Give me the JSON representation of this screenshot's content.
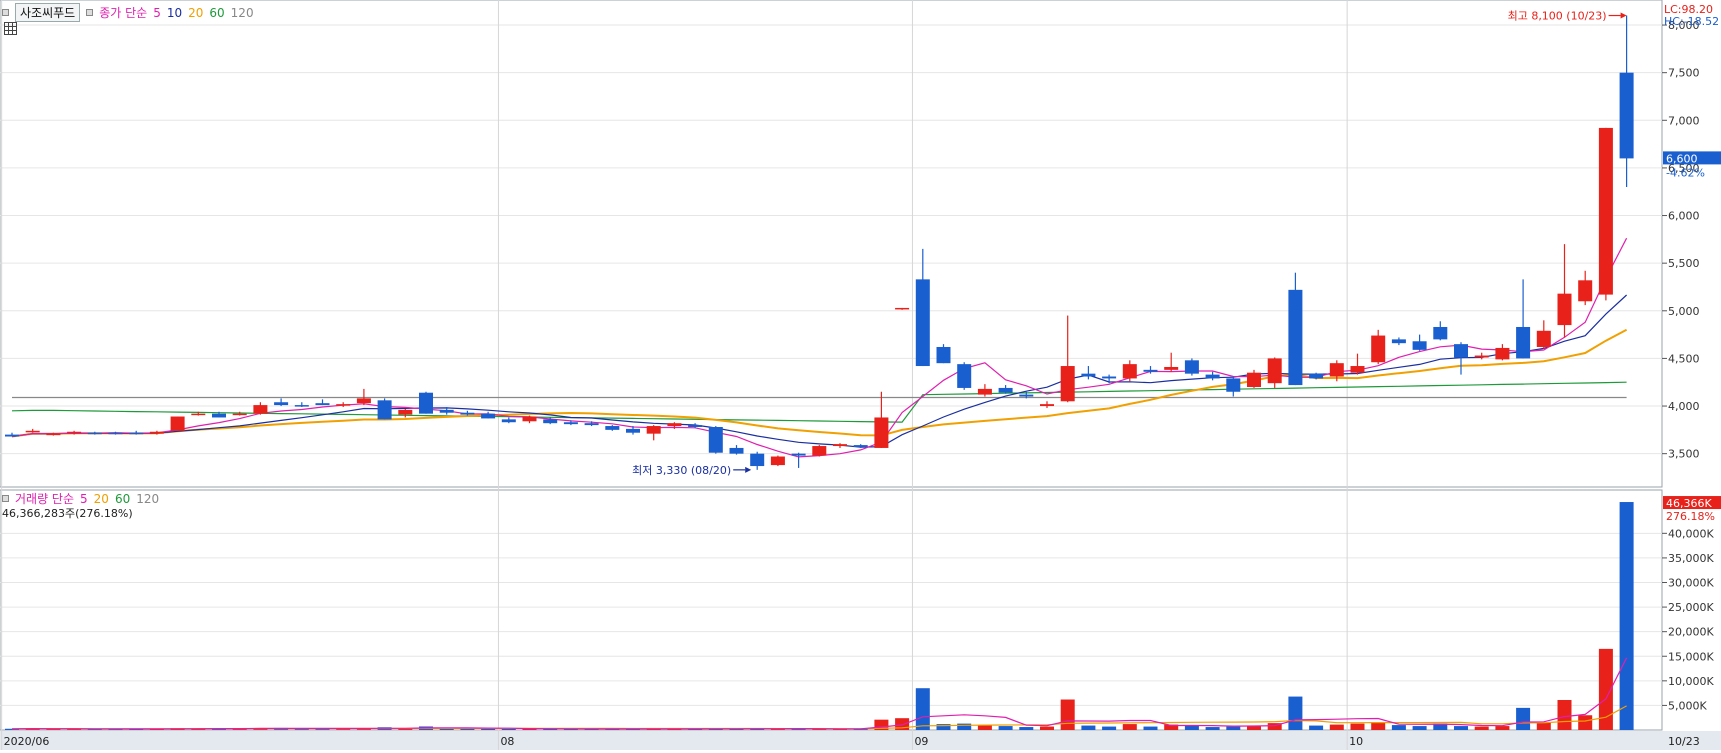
{
  "stock_name": "사조씨푸드",
  "price_legend": {
    "label": "종가 단순",
    "periods": [
      "5",
      "10",
      "20",
      "60",
      "120"
    ]
  },
  "volume_legend": {
    "label": "거래량 단순",
    "periods": [
      "5",
      "20",
      "60",
      "120"
    ]
  },
  "volume_info": "46,366,283주(276.18%)",
  "lc": "LC:98.20",
  "hc": "HC:-18.52",
  "current_price": "6,600",
  "current_change": "-4.62%",
  "current_volume": "46,366K",
  "current_volume_change": "276.18%",
  "annotations": {
    "high": "최고 8,100 (10/23)",
    "low": "최저 3,330 (08/20)"
  },
  "colors": {
    "up": "#e8211a",
    "down": "#1a5fcf",
    "ma5": "#e01fb0",
    "ma10": "#1a2fa0",
    "ma20": "#f0a000",
    "ma60": "#1e9a3a",
    "ma120": "#888888",
    "volma5": "#e01fb0",
    "volma20": "#f0a000"
  },
  "chart_data": [
    {
      "type": "candlestick",
      "title": "사조씨푸드",
      "x_tick_labels": [
        "2020/06",
        "08",
        "09",
        "10",
        "10/23"
      ],
      "x_tick_index": [
        0,
        24,
        44,
        65
      ],
      "last_date_label": "10/23",
      "y_ticks": [
        3500,
        4000,
        4500,
        5000,
        5500,
        6000,
        6500,
        7000,
        7500,
        8000
      ],
      "y_tick_labels": [
        "3,500",
        "4,000",
        "4,500",
        "5,000",
        "5,500",
        "6,000",
        "6,500",
        "7,000",
        "7,500",
        "8,000"
      ],
      "ylim": [
        3150,
        8200
      ],
      "ohlc": [
        [
          3700,
          3720,
          3680,
          3680
        ],
        [
          3730,
          3760,
          3720,
          3740
        ],
        [
          3700,
          3720,
          3690,
          3710
        ],
        [
          3720,
          3740,
          3700,
          3730
        ],
        [
          3720,
          3730,
          3700,
          3710
        ],
        [
          3720,
          3730,
          3700,
          3710
        ],
        [
          3720,
          3740,
          3700,
          3710
        ],
        [
          3710,
          3740,
          3700,
          3730
        ],
        [
          3740,
          3890,
          3740,
          3890
        ],
        [
          3920,
          3940,
          3900,
          3920
        ],
        [
          3920,
          3940,
          3880,
          3880
        ],
        [
          3920,
          3940,
          3900,
          3920
        ],
        [
          3920,
          4040,
          3910,
          4010
        ],
        [
          4040,
          4080,
          4000,
          4010
        ],
        [
          4010,
          4040,
          3990,
          4000
        ],
        [
          4030,
          4070,
          4010,
          4010
        ],
        [
          4010,
          4040,
          3990,
          4020
        ],
        [
          4030,
          4180,
          4010,
          4080
        ],
        [
          4060,
          4080,
          3860,
          3860
        ],
        [
          3910,
          3970,
          3880,
          3960
        ],
        [
          4140,
          4150,
          3920,
          3920
        ],
        [
          3960,
          3990,
          3910,
          3930
        ],
        [
          3930,
          3950,
          3900,
          3910
        ],
        [
          3920,
          3940,
          3870,
          3870
        ],
        [
          3860,
          3880,
          3820,
          3830
        ],
        [
          3840,
          3900,
          3820,
          3890
        ],
        [
          3860,
          3880,
          3810,
          3820
        ],
        [
          3830,
          3850,
          3800,
          3810
        ],
        [
          3820,
          3840,
          3790,
          3800
        ],
        [
          3790,
          3800,
          3740,
          3750
        ],
        [
          3760,
          3790,
          3700,
          3720
        ],
        [
          3710,
          3800,
          3640,
          3790
        ],
        [
          3790,
          3830,
          3760,
          3820
        ],
        [
          3800,
          3820,
          3770,
          3780
        ],
        [
          3780,
          3790,
          3500,
          3510
        ],
        [
          3560,
          3590,
          3490,
          3500
        ],
        [
          3500,
          3520,
          3330,
          3370
        ],
        [
          3380,
          3480,
          3370,
          3470
        ],
        [
          3500,
          3510,
          3350,
          3480
        ],
        [
          3480,
          3590,
          3470,
          3580
        ],
        [
          3580,
          3610,
          3560,
          3600
        ],
        [
          3590,
          3600,
          3560,
          3570
        ],
        [
          3560,
          4150,
          3560,
          3880
        ],
        [
          5030,
          5030,
          5010,
          5030
        ],
        [
          5330,
          5650,
          4420,
          4420
        ],
        [
          4620,
          4650,
          4450,
          4450
        ],
        [
          4440,
          4460,
          4170,
          4190
        ],
        [
          4120,
          4230,
          4100,
          4180
        ],
        [
          4190,
          4220,
          4130,
          4140
        ],
        [
          4120,
          4150,
          4080,
          4100
        ],
        [
          4000,
          4050,
          3980,
          4020
        ],
        [
          4050,
          4950,
          4040,
          4420
        ],
        [
          4340,
          4420,
          4280,
          4310
        ],
        [
          4310,
          4330,
          4240,
          4290
        ],
        [
          4290,
          4480,
          4260,
          4440
        ],
        [
          4380,
          4420,
          4340,
          4360
        ],
        [
          4380,
          4560,
          4360,
          4410
        ],
        [
          4480,
          4500,
          4320,
          4340
        ],
        [
          4330,
          4360,
          4270,
          4290
        ],
        [
          4290,
          4310,
          4100,
          4150
        ],
        [
          4200,
          4380,
          4190,
          4350
        ],
        [
          4240,
          4510,
          4190,
          4500
        ],
        [
          5220,
          5400,
          4220,
          4220
        ],
        [
          4340,
          4350,
          4280,
          4290
        ],
        [
          4310,
          4480,
          4260,
          4450
        ],
        [
          4350,
          4550,
          4330,
          4420
        ],
        [
          4460,
          4800,
          4440,
          4740
        ],
        [
          4700,
          4720,
          4640,
          4660
        ],
        [
          4680,
          4750,
          4580,
          4590
        ],
        [
          4830,
          4890,
          4690,
          4700
        ],
        [
          4650,
          4670,
          4330,
          4510
        ],
        [
          4510,
          4560,
          4490,
          4530
        ],
        [
          4490,
          4650,
          4480,
          4610
        ],
        [
          4830,
          5330,
          4500,
          4500
        ],
        [
          4620,
          4900,
          4600,
          4790
        ],
        [
          4850,
          5700,
          4720,
          5180
        ],
        [
          5100,
          5420,
          5060,
          5320
        ],
        [
          5170,
          6920,
          5110,
          6920
        ],
        [
          7500,
          8100,
          6300,
          6600
        ]
      ],
      "ma_lines": [
        {
          "name": "5",
          "start_value": 3730,
          "end_value": 5730
        },
        {
          "name": "10",
          "start_value": 3720,
          "end_value": 5150
        },
        {
          "name": "20",
          "start_value": 3880,
          "end_value": 4790
        },
        {
          "name": "60",
          "start_value": 3950,
          "end_value": 4250
        },
        {
          "name": "120",
          "start_value": 4090,
          "end_value": 4090
        }
      ]
    },
    {
      "type": "bar",
      "title": "거래량",
      "y_ticks": [
        5000,
        10000,
        15000,
        20000,
        25000,
        30000,
        35000,
        40000
      ],
      "y_tick_labels": [
        "5,000K",
        "10,000K",
        "15,000K",
        "20,000K",
        "25,000K",
        "30,000K",
        "35,000K",
        "40,000K"
      ],
      "ylim": [
        0,
        48000
      ],
      "values_k": [
        250,
        320,
        230,
        260,
        210,
        200,
        230,
        240,
        380,
        300,
        280,
        260,
        380,
        420,
        260,
        300,
        260,
        340,
        560,
        300,
        720,
        320,
        280,
        300,
        250,
        260,
        220,
        200,
        220,
        220,
        230,
        240,
        200,
        220,
        360,
        240,
        300,
        230,
        260,
        260,
        220,
        210,
        2100,
        2400,
        8500,
        1200,
        1300,
        1000,
        800,
        600,
        700,
        6200,
        900,
        700,
        1200,
        700,
        1100,
        900,
        600,
        700,
        800,
        1400,
        6800,
        900,
        1100,
        1300,
        1600,
        1000,
        800,
        1300,
        800,
        700,
        800,
        4500,
        1500,
        6100,
        3000,
        16500,
        46366
      ]
    }
  ]
}
